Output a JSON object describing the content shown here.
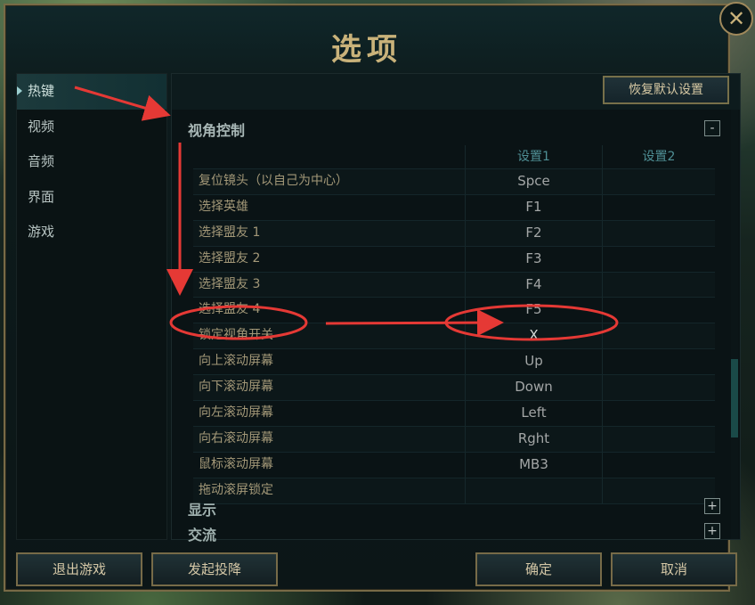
{
  "window": {
    "title": "选项",
    "close_label": "✕"
  },
  "sidebar": {
    "items": [
      {
        "label": "热键",
        "active": true
      },
      {
        "label": "视频"
      },
      {
        "label": "音频"
      },
      {
        "label": "界面"
      },
      {
        "label": "游戏"
      }
    ]
  },
  "toolbar": {
    "reset_label": "恢复默认设置"
  },
  "section": {
    "title": "视角控制",
    "toggle": "-",
    "headers": {
      "binding1": "设置1",
      "binding2": "设置2"
    },
    "rows": [
      {
        "action": "复位镜头（以自己为中心）",
        "binding1": "Spce",
        "binding2": ""
      },
      {
        "action": "选择英雄",
        "binding1": "F1",
        "binding2": ""
      },
      {
        "action": "选择盟友 1",
        "binding1": "F2",
        "binding2": ""
      },
      {
        "action": "选择盟友 2",
        "binding1": "F3",
        "binding2": ""
      },
      {
        "action": "选择盟友 3",
        "binding1": "F4",
        "binding2": ""
      },
      {
        "action": "选择盟友 4",
        "binding1": "F5",
        "binding2": ""
      },
      {
        "action": "锁定视角开关",
        "binding1": "X",
        "binding2": ""
      },
      {
        "action": "向上滚动屏幕",
        "binding1": "Up",
        "binding2": ""
      },
      {
        "action": "向下滚动屏幕",
        "binding1": "Down",
        "binding2": ""
      },
      {
        "action": "向左滚动屏幕",
        "binding1": "Left",
        "binding2": ""
      },
      {
        "action": "向右滚动屏幕",
        "binding1": "Rght",
        "binding2": ""
      },
      {
        "action": "鼠标滚动屏幕",
        "binding1": "MB3",
        "binding2": ""
      },
      {
        "action": "拖动滚屏锁定",
        "binding1": "",
        "binding2": ""
      }
    ]
  },
  "more_sections": [
    {
      "title": "显示",
      "toggle": "+"
    },
    {
      "title": "交流",
      "toggle": "+"
    }
  ],
  "footer": {
    "exit_label": "退出游戏",
    "surrender_label": "发起投降",
    "ok_label": "确定",
    "cancel_label": "取消"
  },
  "colors": {
    "accent_gold": "#c9b27a",
    "annotation_red": "#e53935"
  }
}
